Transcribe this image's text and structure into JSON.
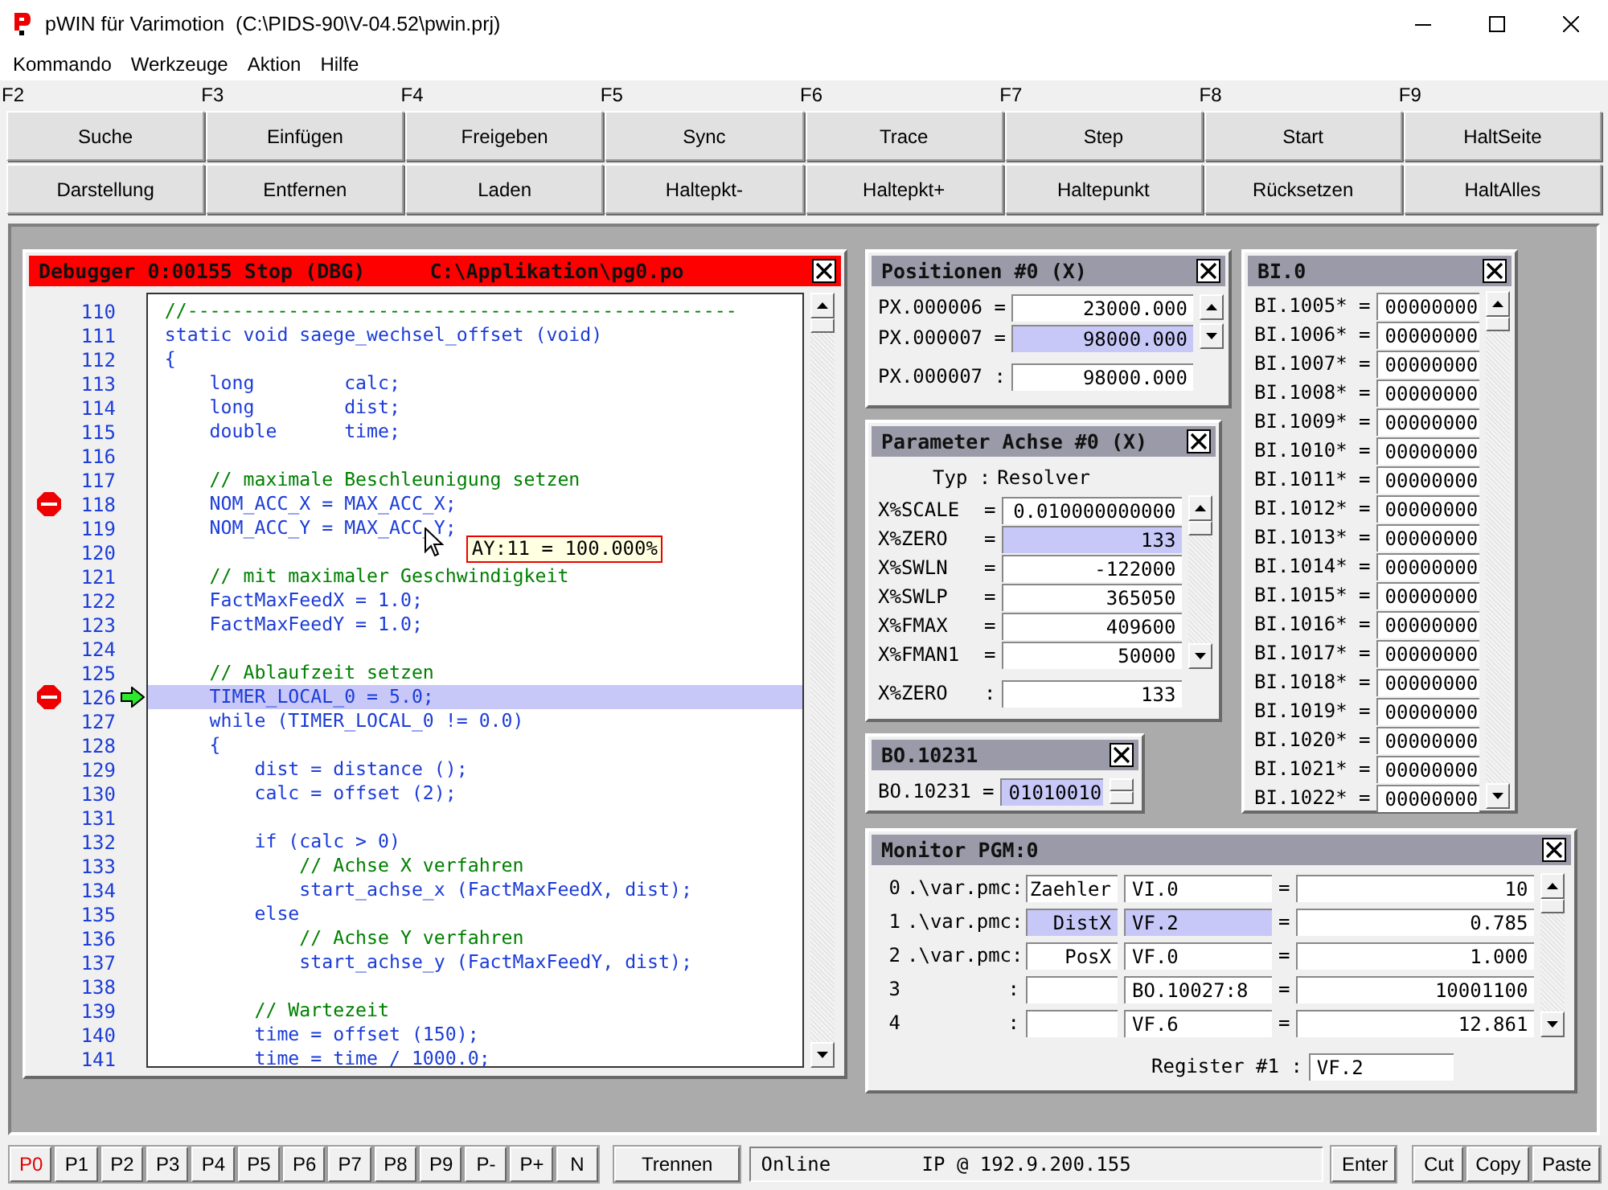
{
  "window": {
    "title": "pWIN für Varimotion  (C:\\PIDS-90\\V-04.52\\pwin.prj)"
  },
  "menu": [
    "Kommando",
    "Werkzeuge",
    "Aktion",
    "Hilfe"
  ],
  "function_keys": [
    {
      "key": "F2",
      "buttons": [
        "Suche",
        "Darstellung"
      ]
    },
    {
      "key": "F3",
      "buttons": [
        "Einfügen",
        "Entfernen"
      ]
    },
    {
      "key": "F4",
      "buttons": [
        "Freigeben",
        "Laden"
      ]
    },
    {
      "key": "F5",
      "buttons": [
        "Sync",
        "Haltepkt-"
      ]
    },
    {
      "key": "F6",
      "buttons": [
        "Trace",
        "Haltepkt+"
      ]
    },
    {
      "key": "F7",
      "buttons": [
        "Step",
        "Haltepunkt"
      ]
    },
    {
      "key": "F8",
      "buttons": [
        "Start",
        "Rücksetzen"
      ]
    },
    {
      "key": "F9",
      "buttons": [
        "HaltSeite",
        "HaltAlles"
      ]
    }
  ],
  "debugger": {
    "title": "Debugger 0:00155 Stop (DBG)",
    "path": "C:\\Applikation\\pg0.po",
    "tooltip": "AY:11 = 100.000%",
    "lines": [
      {
        "number": "110",
        "kind": "comment",
        "text": "//-------------------------------------------------",
        "breakpoint": false,
        "current": false
      },
      {
        "number": "111",
        "kind": "code",
        "text": "static void saege_wechsel_offset (void)",
        "breakpoint": false,
        "current": false
      },
      {
        "number": "112",
        "kind": "code",
        "text": "{",
        "breakpoint": false,
        "current": false
      },
      {
        "number": "113",
        "kind": "code",
        "text": "    long        calc;",
        "breakpoint": false,
        "current": false
      },
      {
        "number": "114",
        "kind": "code",
        "text": "    long        dist;",
        "breakpoint": false,
        "current": false
      },
      {
        "number": "115",
        "kind": "code",
        "text": "    double      time;",
        "breakpoint": false,
        "current": false
      },
      {
        "number": "116",
        "kind": "code",
        "breakpoint": false,
        "current": false
      },
      {
        "number": "117",
        "kind": "comment",
        "text": "    // maximale Beschleunigung setzen",
        "breakpoint": false,
        "current": false
      },
      {
        "number": "118",
        "kind": "code",
        "text": "    NOM_ACC_X = MAX_ACC_X;",
        "breakpoint": true,
        "current": false
      },
      {
        "number": "119",
        "kind": "code",
        "text": "    NOM_ACC_Y = MAX_ACC_Y;",
        "breakpoint": false,
        "current": false
      },
      {
        "number": "120",
        "kind": "code",
        "breakpoint": false,
        "current": false
      },
      {
        "number": "121",
        "kind": "comment",
        "text": "    // mit maximaler Geschwindigkeit",
        "breakpoint": false,
        "current": false
      },
      {
        "number": "122",
        "kind": "code",
        "text": "    FactMaxFeedX = 1.0;",
        "breakpoint": false,
        "current": false
      },
      {
        "number": "123",
        "kind": "code",
        "text": "    FactMaxFeedY = 1.0;",
        "breakpoint": false,
        "current": false
      },
      {
        "number": "124",
        "kind": "code",
        "breakpoint": false,
        "current": false
      },
      {
        "number": "125",
        "kind": "comment",
        "text": "    // Ablaufzeit setzen",
        "breakpoint": false,
        "current": false
      },
      {
        "number": "126",
        "kind": "code",
        "text": "    TIMER_LOCAL_0 = 5.0;",
        "breakpoint": true,
        "current": true
      },
      {
        "number": "127",
        "kind": "code",
        "text": "    while (TIMER_LOCAL_0 != 0.0)",
        "breakpoint": false,
        "current": false
      },
      {
        "number": "128",
        "kind": "code",
        "text": "    {",
        "breakpoint": false,
        "current": false
      },
      {
        "number": "129",
        "kind": "code",
        "text": "        dist = distance ();",
        "breakpoint": false,
        "current": false
      },
      {
        "number": "130",
        "kind": "code",
        "text": "        calc = offset (2);",
        "breakpoint": false,
        "current": false
      },
      {
        "number": "131",
        "kind": "code",
        "breakpoint": false,
        "current": false
      },
      {
        "number": "132",
        "kind": "code",
        "text": "        if (calc > 0)",
        "breakpoint": false,
        "current": false
      },
      {
        "number": "133",
        "kind": "comment",
        "text": "            // Achse X verfahren",
        "breakpoint": false,
        "current": false
      },
      {
        "number": "134",
        "kind": "code",
        "text": "            start_achse_x (FactMaxFeedX, dist);",
        "breakpoint": false,
        "current": false
      },
      {
        "number": "135",
        "kind": "code",
        "text": "        else",
        "breakpoint": false,
        "current": false
      },
      {
        "number": "136",
        "kind": "comment",
        "text": "            // Achse Y verfahren",
        "breakpoint": false,
        "current": false
      },
      {
        "number": "137",
        "kind": "code",
        "text": "            start_achse_y (FactMaxFeedY, dist);",
        "breakpoint": false,
        "current": false
      },
      {
        "number": "138",
        "kind": "code",
        "breakpoint": false,
        "current": false
      },
      {
        "number": "139",
        "kind": "comment",
        "text": "        // Wartezeit",
        "breakpoint": false,
        "current": false
      },
      {
        "number": "140",
        "kind": "code",
        "text": "        time = offset (150);",
        "breakpoint": false,
        "current": false
      },
      {
        "number": "141",
        "kind": "code",
        "text": "        time = time / 1000.0;",
        "breakpoint": false,
        "current": false
      }
    ]
  },
  "positions": {
    "title": "Positionen #0 (X)",
    "rows": [
      {
        "label": "PX.000006 =",
        "value": "23000.000",
        "selected": false
      },
      {
        "label": "PX.000007 =",
        "value": "98000.000",
        "selected": true
      }
    ],
    "summary": {
      "label": "PX.000007 :",
      "value": "98000.000"
    }
  },
  "parameters": {
    "title": "Parameter Achse #0 (X)",
    "type_label": "Typ :",
    "type_value": "Resolver",
    "rows": [
      {
        "label": "X%SCALE",
        "sep": "=",
        "value": "0.010000000000",
        "selected": false
      },
      {
        "label": "X%ZERO",
        "sep": "=",
        "value": "133",
        "selected": true
      },
      {
        "label": "X%SWLN",
        "sep": "=",
        "value": "-122000",
        "selected": false
      },
      {
        "label": "X%SWLP",
        "sep": "=",
        "value": "365050",
        "selected": false
      },
      {
        "label": "X%FMAX",
        "sep": "=",
        "value": "409600",
        "selected": false
      },
      {
        "label": "X%FMAN1",
        "sep": "=",
        "value": "50000",
        "selected": false
      }
    ],
    "summary": {
      "label": "X%ZERO",
      "sep": ":",
      "value": "133"
    }
  },
  "bo": {
    "title": "BO.10231",
    "label": "BO.10231 =",
    "value": "01010010"
  },
  "bi": {
    "title": "BI.0",
    "rows": [
      {
        "label": "BI.1005* =",
        "value": "00000000"
      },
      {
        "label": "BI.1006* =",
        "value": "00000000"
      },
      {
        "label": "BI.1007* =",
        "value": "00000000"
      },
      {
        "label": "BI.1008* =",
        "value": "00000000"
      },
      {
        "label": "BI.1009* =",
        "value": "00000000"
      },
      {
        "label": "BI.1010* =",
        "value": "00000000"
      },
      {
        "label": "BI.1011* =",
        "value": "00000000"
      },
      {
        "label": "BI.1012* =",
        "value": "00000000"
      },
      {
        "label": "BI.1013* =",
        "value": "00000000"
      },
      {
        "label": "BI.1014* =",
        "value": "00000000"
      },
      {
        "label": "BI.1015* =",
        "value": "00000000"
      },
      {
        "label": "BI.1016* =",
        "value": "00000000"
      },
      {
        "label": "BI.1017* =",
        "value": "00000000"
      },
      {
        "label": "BI.1018* =",
        "value": "00000000"
      },
      {
        "label": "BI.1019* =",
        "value": "00000000"
      },
      {
        "label": "BI.1020* =",
        "value": "00000000"
      },
      {
        "label": "BI.1021* =",
        "value": "00000000"
      },
      {
        "label": "BI.1022* =",
        "value": "00000000"
      }
    ]
  },
  "monitor": {
    "title": "Monitor PGM:0",
    "register_label": "Register #1 :",
    "register_value": "VF.2",
    "rows": [
      {
        "index": "0",
        "file": ".\\var.pmc:",
        "name": "Zaehler",
        "register": "VI.0",
        "sep": "=",
        "value": "10",
        "selected": false
      },
      {
        "index": "1",
        "file": ".\\var.pmc:",
        "name": "DistX",
        "register": "VF.2",
        "sep": "=",
        "value": "0.785",
        "selected": true
      },
      {
        "index": "2",
        "file": ".\\var.pmc:",
        "name": "PosX",
        "register": "VF.0",
        "sep": "=",
        "value": "1.000",
        "selected": false
      },
      {
        "index": "3",
        "file": ":",
        "register": "BO.10027:8",
        "sep": "=",
        "value": "10001100",
        "selected": false
      },
      {
        "index": "4",
        "file": ":",
        "register": "VF.6",
        "sep": "=",
        "value": "12.861",
        "selected": false
      }
    ]
  },
  "bottom_bar": {
    "programs": [
      {
        "label": "P0",
        "selected": true
      },
      {
        "label": "P1",
        "selected": false
      },
      {
        "label": "P2",
        "selected": false
      },
      {
        "label": "P3",
        "selected": false
      },
      {
        "label": "P4",
        "selected": false
      },
      {
        "label": "P5",
        "selected": false
      },
      {
        "label": "P6",
        "selected": false
      },
      {
        "label": "P7",
        "selected": false
      },
      {
        "label": "P8",
        "selected": false
      },
      {
        "label": "P9",
        "selected": false
      },
      {
        "label": "P-",
        "selected": false
      },
      {
        "label": "P+",
        "selected": false
      },
      {
        "label": "N",
        "selected": false
      }
    ],
    "disconnect_button": "Trennen",
    "status": "Online",
    "ip": "IP @ 192.9.200.155",
    "enter_button": "Enter",
    "edit_buttons": [
      "Cut",
      "Copy",
      "Paste"
    ]
  }
}
